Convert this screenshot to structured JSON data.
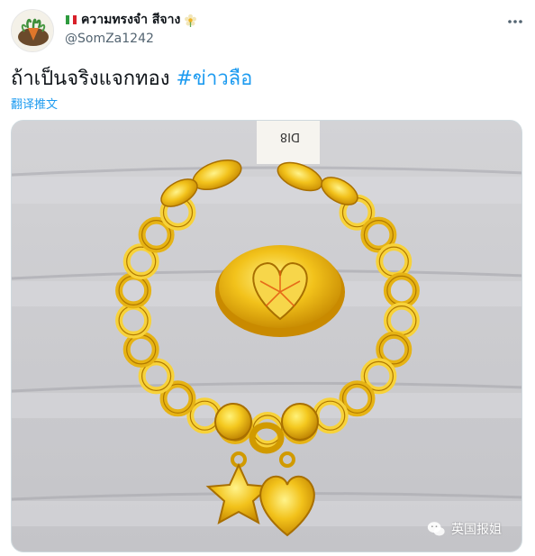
{
  "tweet": {
    "display_name": "ความทรงจำ สีจาง",
    "handle": "@SomZa1242",
    "text": "ถ้าเป็นจริงแจกทอง",
    "hashtag": "#ข่าวลือ",
    "translate_label": "翻译推文"
  },
  "media": {
    "tag_text": "DI8",
    "watermark": "英国报姐"
  },
  "icons": {
    "more": "more-horizontal-icon",
    "flag": "flag-icon",
    "flower": "flower-icon",
    "watermark": "wechat-icon"
  },
  "colors": {
    "hashtag": "#1d9bf0",
    "gold": "#f2c21b",
    "gold_dark": "#c98a00",
    "velvet": "#cfcfd2"
  }
}
